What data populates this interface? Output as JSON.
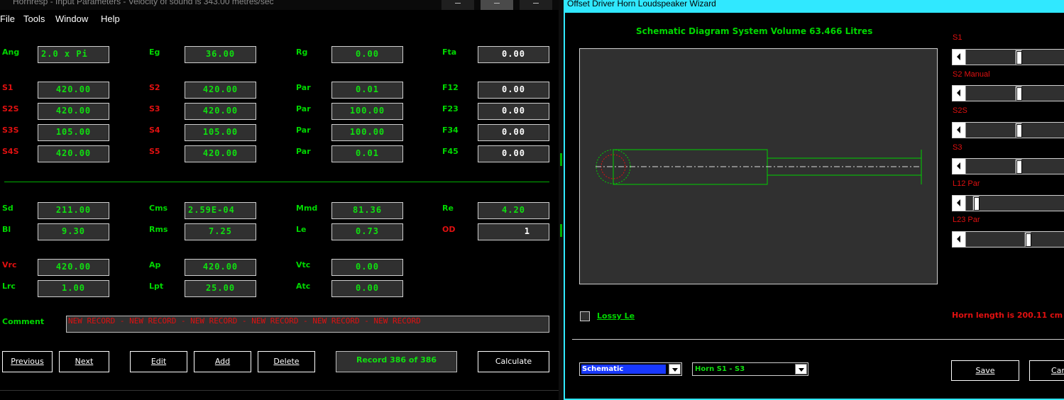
{
  "left_window": {
    "title": "Hornresp - Input Parameters - Velocity of sound is 343.00 metres/sec",
    "menu": [
      "File",
      "Tools",
      "Window",
      "Help"
    ],
    "params": {
      "ang": {
        "label": "Ang",
        "value": "2.0 x Pi"
      },
      "eg": {
        "label": "Eg",
        "value": "36.00"
      },
      "rg": {
        "label": "Rg",
        "value": "0.00"
      },
      "fta": {
        "label": "Fta",
        "value": "0.00"
      },
      "s1": {
        "label": "S1",
        "value": "420.00"
      },
      "s2": {
        "label": "S2",
        "value": "420.00"
      },
      "par1": {
        "label": "Par",
        "value": "0.01"
      },
      "f12": {
        "label": "F12",
        "value": "0.00"
      },
      "s2s": {
        "label": "S2S",
        "value": "420.00"
      },
      "s3": {
        "label": "S3",
        "value": "420.00"
      },
      "par2": {
        "label": "Par",
        "value": "100.00"
      },
      "f23": {
        "label": "F23",
        "value": "0.00"
      },
      "s3s": {
        "label": "S3S",
        "value": "105.00"
      },
      "s4": {
        "label": "S4",
        "value": "105.00"
      },
      "par3": {
        "label": "Par",
        "value": "100.00"
      },
      "f34": {
        "label": "F34",
        "value": "0.00"
      },
      "s4s": {
        "label": "S4S",
        "value": "420.00"
      },
      "s5": {
        "label": "S5",
        "value": "420.00"
      },
      "par4": {
        "label": "Par",
        "value": "0.01"
      },
      "f45": {
        "label": "F45",
        "value": "0.00"
      },
      "sd": {
        "label": "Sd",
        "value": "211.00"
      },
      "cms": {
        "label": "Cms",
        "value": "2.59E-04"
      },
      "mmd": {
        "label": "Mmd",
        "value": "81.36"
      },
      "re": {
        "label": "Re",
        "value": "4.20"
      },
      "bl": {
        "label": "Bl",
        "value": "9.30"
      },
      "rms": {
        "label": "Rms",
        "value": "7.25"
      },
      "le": {
        "label": "Le",
        "value": "0.73"
      },
      "od": {
        "label": "OD",
        "value": "1"
      },
      "vrc": {
        "label": "Vrc",
        "value": "420.00"
      },
      "ap": {
        "label": "Ap",
        "value": "420.00"
      },
      "vtc": {
        "label": "Vtc",
        "value": "0.00"
      },
      "lrc": {
        "label": "Lrc",
        "value": "1.00"
      },
      "lpt": {
        "label": "Lpt",
        "value": "25.00"
      },
      "atc": {
        "label": "Atc",
        "value": "0.00"
      }
    },
    "comment": {
      "label": "Comment",
      "value": "NEW RECORD - NEW RECORD - NEW RECORD - NEW RECORD - NEW RECORD - NEW RECORD"
    },
    "buttons": {
      "previous": "Previous",
      "next": "Next",
      "edit": "Edit",
      "add": "Add",
      "delete": "Delete",
      "calculate": "Calculate"
    },
    "record_status": "Record 386 of 386"
  },
  "wizard": {
    "title": "Offset Driver Horn Loudspeaker Wizard",
    "schematic_title": "Schematic Diagram   System Volume 63.466 Litres",
    "sliders": [
      {
        "label": "S1",
        "position": 0.52
      },
      {
        "label": "S2 Manual",
        "position": 0.52
      },
      {
        "label": "S2S",
        "position": 0.52
      },
      {
        "label": "S3",
        "position": 0.52
      },
      {
        "label": "L12 Par",
        "position": 0.06
      },
      {
        "label": "L23 Par",
        "position": 0.62
      }
    ],
    "lossy_le": {
      "label": "Lossy Le",
      "checked": false
    },
    "horn_length": "Horn length is 200.11 cm",
    "view_select": "Schematic",
    "range_select": "Horn S1 - S3",
    "save_label": "Save",
    "cancel_label": "Can"
  },
  "colors": {
    "label_green": "#00d800",
    "label_red": "#e01010",
    "value_green": "#10e010",
    "panel_bg": "#303030",
    "wizard_border": "#30e8ff",
    "select_highlight": "#1838ff"
  }
}
